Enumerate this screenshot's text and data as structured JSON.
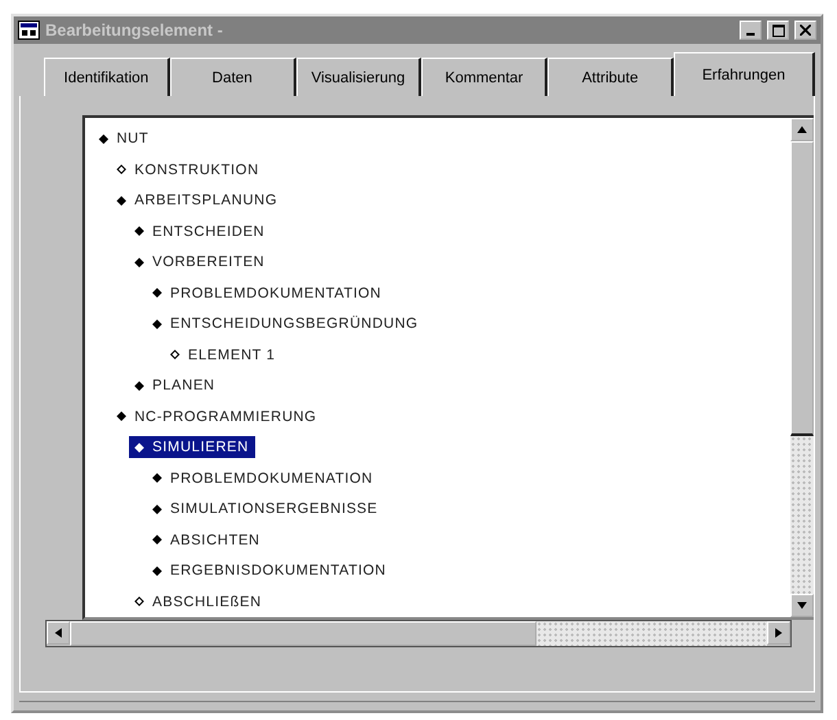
{
  "window": {
    "title": "Bearbeitungselement -"
  },
  "tabs": [
    {
      "label": "Identifikation",
      "selected": false
    },
    {
      "label": "Daten",
      "selected": false
    },
    {
      "label": "Visualisierung",
      "selected": false
    },
    {
      "label": "Kommentar",
      "selected": false
    },
    {
      "label": "Attribute",
      "selected": false
    },
    {
      "label": "Erfahrungen",
      "selected": true
    }
  ],
  "tree": [
    {
      "label": "NUT",
      "kind": "filled",
      "selected": false,
      "children": [
        {
          "label": "KONSTRUKTION",
          "kind": "hollow",
          "selected": false
        },
        {
          "label": "ARBEITSPLANUNG",
          "kind": "filled",
          "selected": false,
          "children": [
            {
              "label": "ENTSCHEIDEN",
              "kind": "filled",
              "selected": false
            },
            {
              "label": "VORBEREITEN",
              "kind": "filled",
              "selected": false,
              "children": [
                {
                  "label": "PROBLEMDOKUMENTATION",
                  "kind": "filled",
                  "selected": false
                },
                {
                  "label": "ENTSCHEIDUNGSBEGRÜNDUNG",
                  "kind": "filled",
                  "selected": false,
                  "children": [
                    {
                      "label": "ELEMENT 1",
                      "kind": "hollow",
                      "selected": false
                    }
                  ]
                }
              ]
            },
            {
              "label": "PLANEN",
              "kind": "filled",
              "selected": false
            }
          ]
        },
        {
          "label": "NC-PROGRAMMIERUNG",
          "kind": "filled",
          "selected": false,
          "children": [
            {
              "label": "SIMULIEREN",
              "kind": "filled",
              "selected": true,
              "children": [
                {
                  "label": "PROBLEMDOKUMENATION",
                  "kind": "filled",
                  "selected": false
                },
                {
                  "label": "SIMULATIONSERGEBNISSE",
                  "kind": "filled",
                  "selected": false
                },
                {
                  "label": "ABSICHTEN",
                  "kind": "filled",
                  "selected": false
                },
                {
                  "label": "ERGEBNISDOKUMENTATION",
                  "kind": "filled",
                  "selected": false
                }
              ]
            },
            {
              "label": "ABSCHLIEßEN",
              "kind": "hollow",
              "selected": false
            }
          ]
        }
      ]
    }
  ]
}
